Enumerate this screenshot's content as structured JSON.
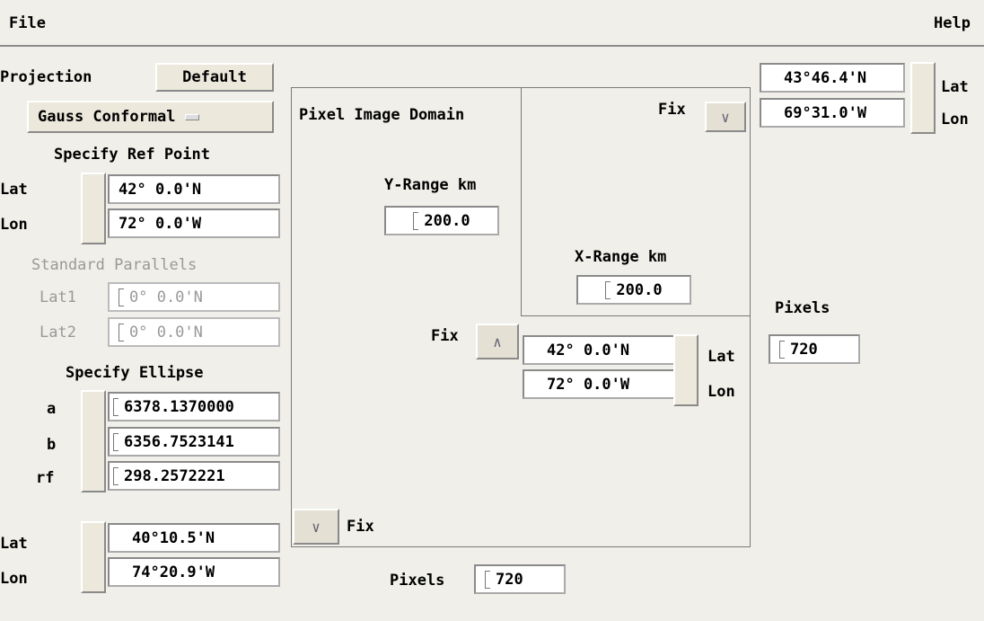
{
  "menu": {
    "file": "File",
    "help": "Help"
  },
  "projection": {
    "label": "Projection",
    "default_button": "Default",
    "type": "Gauss Conformal",
    "ref_point_title": "Specify Ref Point",
    "ref_lat_label": "Lat",
    "ref_lat": "42° 0.0'N",
    "ref_lon_label": "Lon",
    "ref_lon": "72° 0.0'W",
    "std_parallels_title": "Standard Parallels",
    "lat1_label": "Lat1",
    "lat1": "0° 0.0'N",
    "lat2_label": "Lat2",
    "lat2": "0° 0.0'N",
    "ellipse_title": "Specify Ellipse",
    "a_label": "a",
    "a": "6378.1370000",
    "b_label": "b",
    "b": "6356.7523141",
    "rf_label": "rf",
    "rf": "298.2572221",
    "bottom_lat_label": "Lat",
    "bottom_lat": "40°10.5'N",
    "bottom_lon_label": "Lon",
    "bottom_lon": "74°20.9'W"
  },
  "domain": {
    "title": "Pixel Image Domain",
    "fix_top": "Fix",
    "y_range_label": "Y-Range km",
    "y_range": "200.0",
    "x_range_label": "X-Range km",
    "x_range": "200.0",
    "fix_mid": "Fix",
    "center_lat": "42° 0.0'N",
    "center_lat_label": "Lat",
    "center_lon": "72° 0.0'W",
    "center_lon_label": "Lon",
    "fix_bottom": "Fix",
    "pixels_bottom_label": "Pixels",
    "pixels_bottom": "720"
  },
  "right": {
    "lat": "43°46.4'N",
    "lat_label": "Lat",
    "lon": "69°31.0'W",
    "lon_label": "Lon",
    "pixels_label": "Pixels",
    "pixels": "720"
  },
  "icons": {
    "down": "chevron-down-icon",
    "up": "chevron-up-icon",
    "option": "option-menu-icon"
  }
}
